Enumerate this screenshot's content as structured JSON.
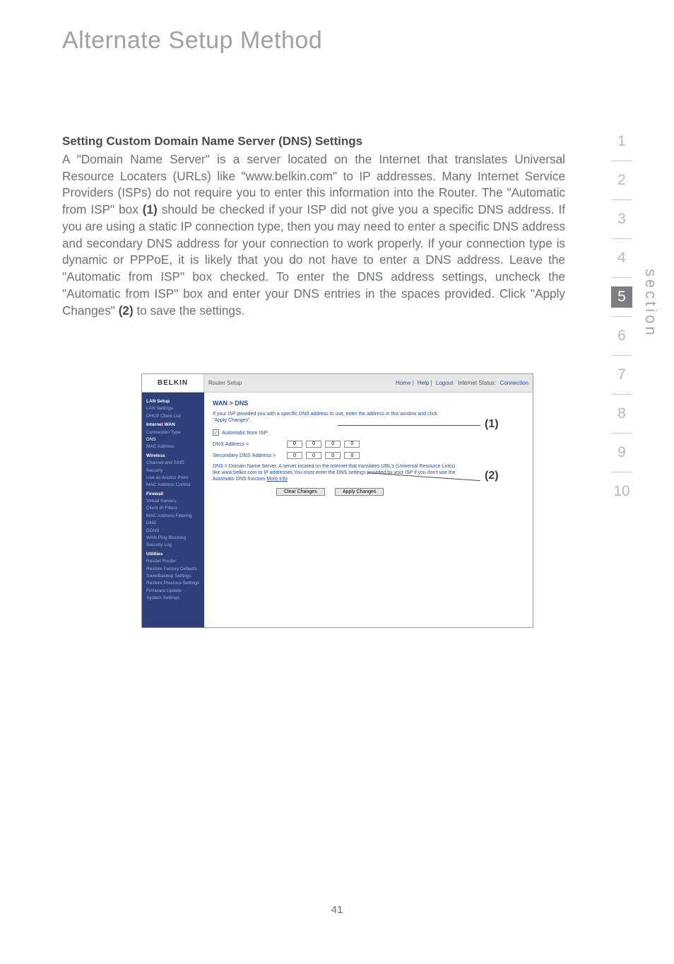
{
  "page": {
    "title": "Alternate Setup Method",
    "section_label": "section",
    "page_number": "41"
  },
  "tabs": {
    "items": [
      "1",
      "2",
      "3",
      "4",
      "5",
      "6",
      "7",
      "8",
      "9",
      "10"
    ],
    "active_index": 4
  },
  "content": {
    "subhead": "Setting Custom Domain Name Server (DNS) Settings",
    "p1a": "A \"Domain Name Server\" is a server located on the Internet that translates Universal Resource Locaters (URLs) like \"www.belkin.com\" to IP addresses. Many Internet Service Providers (ISPs) do not require you to enter this information into the Router. The \"Automatic from ISP\" box ",
    "p1b_bold": "(1)",
    "p1c": " should be checked if your ISP did not give you a specific DNS address. If you are using a static IP connection type, then you may need to enter a specific DNS address and secondary DNS address for your connection to work properly. If your connection type is dynamic or PPPoE, it is likely that you do not have to enter a DNS address. Leave the \"Automatic from ISP\" box checked. To enter the DNS address settings, uncheck the \"Automatic from ISP\" box and enter your DNS entries in the spaces provided. Click \"Apply Changes\" ",
    "p1d_bold": "(2)",
    "p1e": " to save the settings."
  },
  "callouts": {
    "one": "(1)",
    "two": "(2)"
  },
  "router": {
    "logo": "BELKIN",
    "topbar_title": "Router Setup",
    "topbar_links": {
      "home": "Home",
      "help": "Help",
      "logout": "Logout",
      "status_label": "Internet Status:",
      "status_value": "Connection"
    },
    "sidebar": {
      "g1": "LAN Setup",
      "g1_items": [
        "LAN Settings",
        "DHCP Client List"
      ],
      "g2": "Internet WAN",
      "g2_items": [
        "Connection Type",
        "DNS",
        "MAC Address"
      ],
      "g3": "Wireless",
      "g3_items": [
        "Channel and SSID",
        "Security",
        "Use as Access Point",
        "MAC Address Control"
      ],
      "g4": "Firewall",
      "g4_items": [
        "Virtual Servers",
        "Client IP Filters",
        "MAC Address Filtering",
        "DMZ",
        "DDNS",
        "WAN Ping Blocking",
        "Security Log"
      ],
      "g5": "Utilities",
      "g5_items": [
        "Restart Router",
        "Restore Factory Defaults",
        "Save/Backup Settings",
        "Restore Previous Settings",
        "Firmware Update",
        "System Settings"
      ]
    },
    "main": {
      "breadcrumb": "WAN > DNS",
      "intro": "If your ISP provided you with a specific DNS address to use, enter the address in this window and click \"Apply Changes\".",
      "auto_label": "Automatic from ISP",
      "auto_checked": true,
      "dns_label": "DNS Address >",
      "sec_dns_label": "Secondary DNS Address >",
      "ip_default": "0",
      "note": "DNS = Domain Name Server. A server located on the Internet that translates URL's (Universal Resource Links) like www.belkin.com to IP addresses.You must enter the DNS settings provided by your ISP if you don't use the Automatic DNS function ",
      "more_info": "More Info",
      "btn_clear": "Clear Changes",
      "btn_apply": "Apply Changes"
    }
  }
}
